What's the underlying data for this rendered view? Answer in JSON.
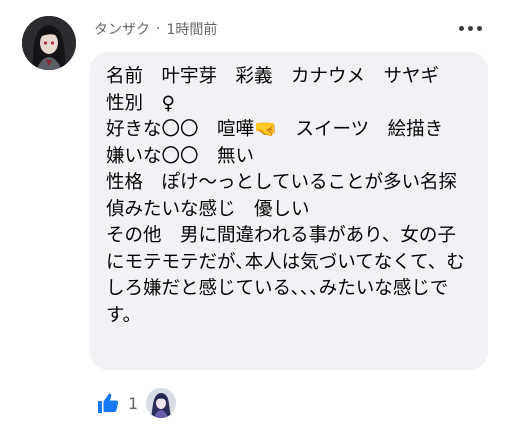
{
  "comment": {
    "author": "タンザク",
    "separator": "·",
    "time": "1時間前",
    "text": "名前　叶宇芽　彩義　カナウメ　サヤギ　性別　♀\n好きな〇〇　喧嘩🤜　スイーツ　絵描き\n嫌いな〇〇　無い\n性格　ぽけ〜っとしていることが多い名探偵みたいな感じ　優しい\nその他　男に間違われる事があり、女の子にモテモテだが､本人は気づいてなくて、むしろ嫌だと感じている､､､みたいな感じです。"
  },
  "reactions": {
    "icon": "thumbs-up-icon",
    "count": "1",
    "color": "#1877f2"
  },
  "colors": {
    "bubble": "#f0f2f5",
    "meta_text": "#65676b",
    "body_text": "#050505"
  }
}
